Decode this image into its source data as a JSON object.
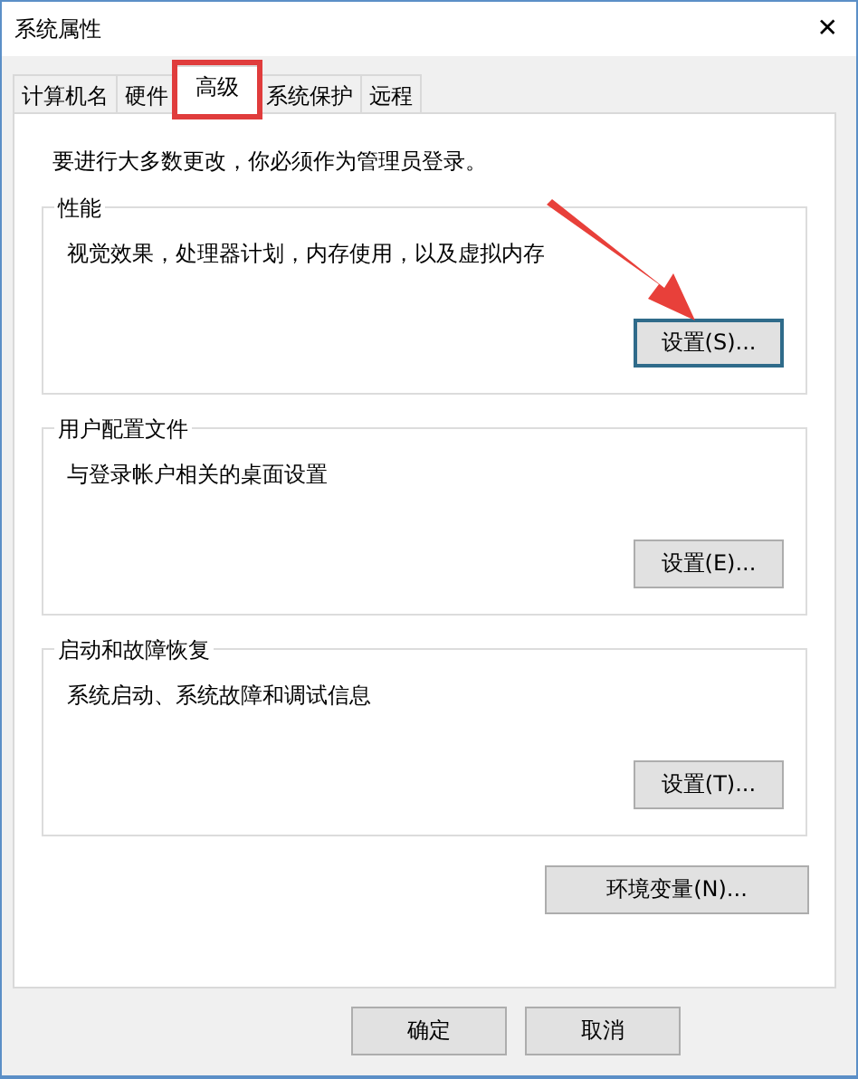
{
  "window": {
    "title": "系统属性",
    "close": "✕"
  },
  "tabs": [
    {
      "label": "计算机名",
      "selected": false,
      "highlighted": false
    },
    {
      "label": "硬件",
      "selected": false,
      "highlighted": false
    },
    {
      "label": "高级",
      "selected": true,
      "highlighted": true
    },
    {
      "label": "系统保护",
      "selected": false,
      "highlighted": false
    },
    {
      "label": "远程",
      "selected": false,
      "highlighted": false
    }
  ],
  "notice": "要进行大多数更改，你必须作为管理员登录。",
  "groups": [
    {
      "title": "性能",
      "description": "视觉效果，处理器计划，内存使用，以及虚拟内存",
      "button": "设置(S)...",
      "focused": true,
      "pointed": true
    },
    {
      "title": "用户配置文件",
      "description": "与登录帐户相关的桌面设置",
      "button": "设置(E)...",
      "focused": false,
      "pointed": false
    },
    {
      "title": "启动和故障恢复",
      "description": "系统启动、系统故障和调试信息",
      "button": "设置(T)...",
      "focused": false,
      "pointed": false
    }
  ],
  "env_button": "环境变量(N)...",
  "buttons": [
    "确定",
    "取消"
  ]
}
